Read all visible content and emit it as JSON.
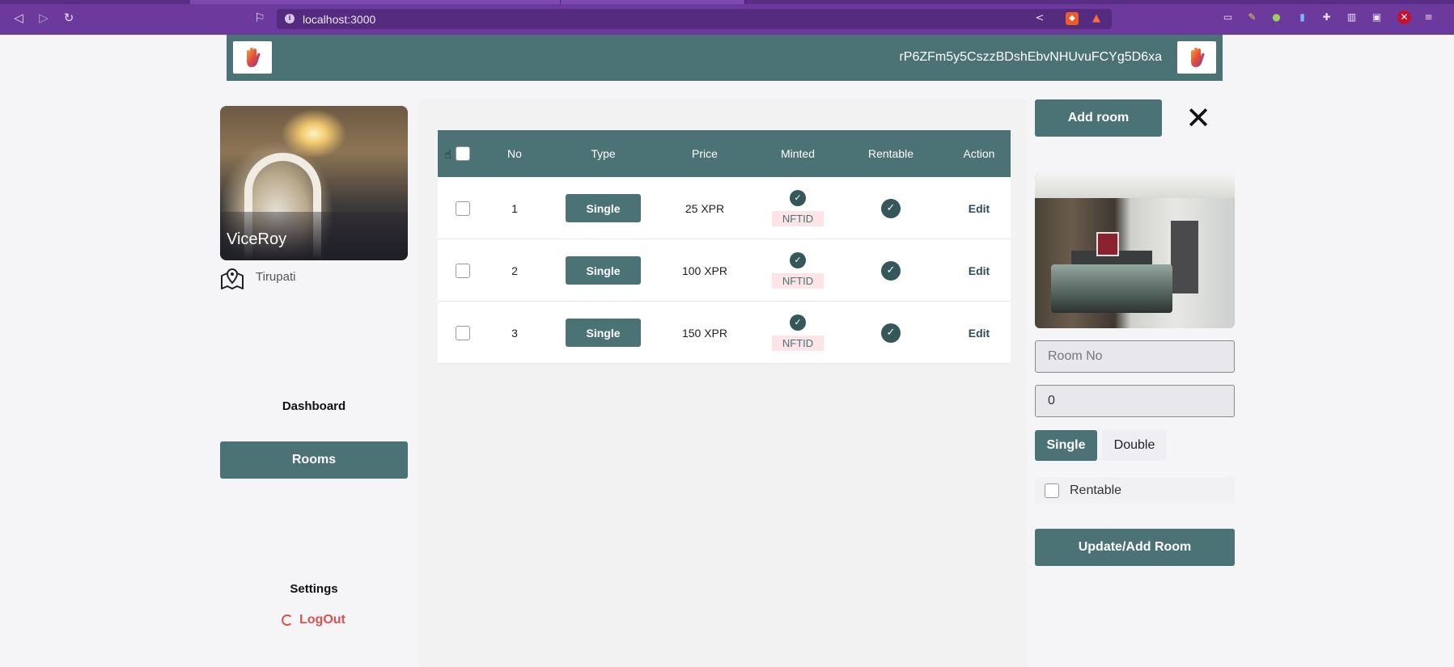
{
  "browser": {
    "url": "localhost:3000",
    "nav": {
      "back_icon": "back-arrow-icon",
      "forward_icon": "forward-arrow-icon",
      "reload_icon": "reload-icon"
    },
    "accent": "#6c3a9c"
  },
  "header": {
    "wallet_address": "rP6ZFm5y5CszzBDshEbvNHUvuFCYg5D6xa",
    "logo_icon": "hand-logo-icon",
    "color": "#4b7275"
  },
  "sidebar": {
    "hotel_name": "ViceRoy",
    "location": "Tirupati",
    "dashboard_label": "Dashboard",
    "rooms_label": "Rooms",
    "settings_label": "Settings",
    "logout_label": "LogOut"
  },
  "table": {
    "columns": [
      "No",
      "Type",
      "Price",
      "Minted",
      "Rentable",
      "Action"
    ],
    "rows": [
      {
        "no": "1",
        "type": "Single",
        "price": "25 XPR",
        "minted_tag": "NFTID",
        "action": "Edit"
      },
      {
        "no": "2",
        "type": "Single",
        "price": "100 XPR",
        "minted_tag": "NFTID",
        "action": "Edit"
      },
      {
        "no": "3",
        "type": "Single",
        "price": "150 XPR",
        "minted_tag": "NFTID",
        "action": "Edit"
      }
    ]
  },
  "form": {
    "add_room_label": "Add room",
    "close_icon": "close-icon",
    "room_no_placeholder": "Room No",
    "price_value": "0",
    "type_single": "Single",
    "type_double": "Double",
    "rentable_label": "Rentable",
    "submit_label": "Update/Add Room"
  }
}
